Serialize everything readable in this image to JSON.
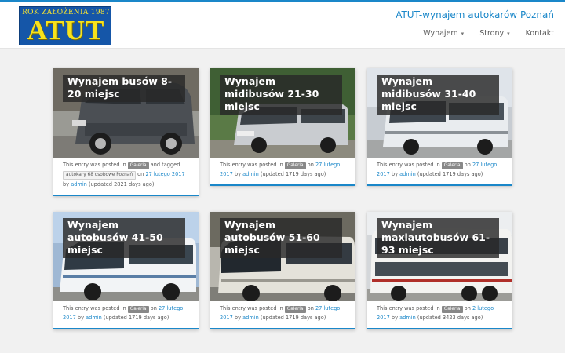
{
  "logo": {
    "since_text": "ROK ZAŁOŻENIA 1987",
    "name": "ATUT"
  },
  "site": {
    "title": "ATUT-wynajem autokarów Poznań"
  },
  "nav": {
    "items": [
      {
        "label": "Wynajem",
        "dropdown": true
      },
      {
        "label": "Strony",
        "dropdown": true
      },
      {
        "label": "Kontakt",
        "dropdown": false
      }
    ],
    "caret": "▾"
  },
  "colors": {
    "accent": "#1a87c9",
    "logo_bg": "#1556a8",
    "logo_text": "#f7e21c"
  },
  "posts": [
    {
      "title": "Wynajem busów 8-20 miejsc",
      "image": "minivan-photo",
      "posted_prefix": "This entry was posted in",
      "category": "Galeria",
      "tagged_text": "and tagged",
      "tag": "autokary 68 osobowe Poznań",
      "on_text": "on",
      "date": "27 lutego 2017",
      "by_text": "by",
      "author": "admin",
      "updated": "(updated 2821 days ago)"
    },
    {
      "title": "Wynajem midibusów 21-30 miejsc",
      "image": "midibus-photo",
      "posted_prefix": "This entry was posted in",
      "category": "Galeria",
      "on_text": "on",
      "date": "27 lutego 2017",
      "by_text": "by",
      "author": "admin",
      "updated": "(updated 1719 days ago)"
    },
    {
      "title": "Wynajem midibusów 31-40 miejsc",
      "image": "midibus-photo",
      "posted_prefix": "This entry was posted in",
      "category": "Galeria",
      "on_text": "on",
      "date": "27 lutego 2017",
      "by_text": "by",
      "author": "admin",
      "updated": "(updated 1719 days ago)"
    },
    {
      "title": "Wynajem autobusów 41-50 miejsc",
      "image": "coach-photo",
      "posted_prefix": "This entry was posted in",
      "category": "Galeria",
      "on_text": "on",
      "date": "27 lutego 2017",
      "by_text": "by",
      "author": "admin",
      "updated": "(updated 1719 days ago)"
    },
    {
      "title": "Wynajem autobusów 51-60 miejsc",
      "image": "coach-photo",
      "posted_prefix": "This entry was posted in",
      "category": "Galeria",
      "on_text": "on",
      "date": "27 lutego 2017",
      "by_text": "by",
      "author": "admin",
      "updated": "(updated 1719 days ago)"
    },
    {
      "title": "Wynajem maxiautobusów 61-93 miejsc",
      "image": "double-decker-photo",
      "posted_prefix": "This entry was posted in",
      "category": "Galeria",
      "on_text": "on",
      "date": "2 lutego 2017",
      "by_text": "by",
      "author": "admin",
      "updated": "(updated 3423 days ago)"
    }
  ]
}
